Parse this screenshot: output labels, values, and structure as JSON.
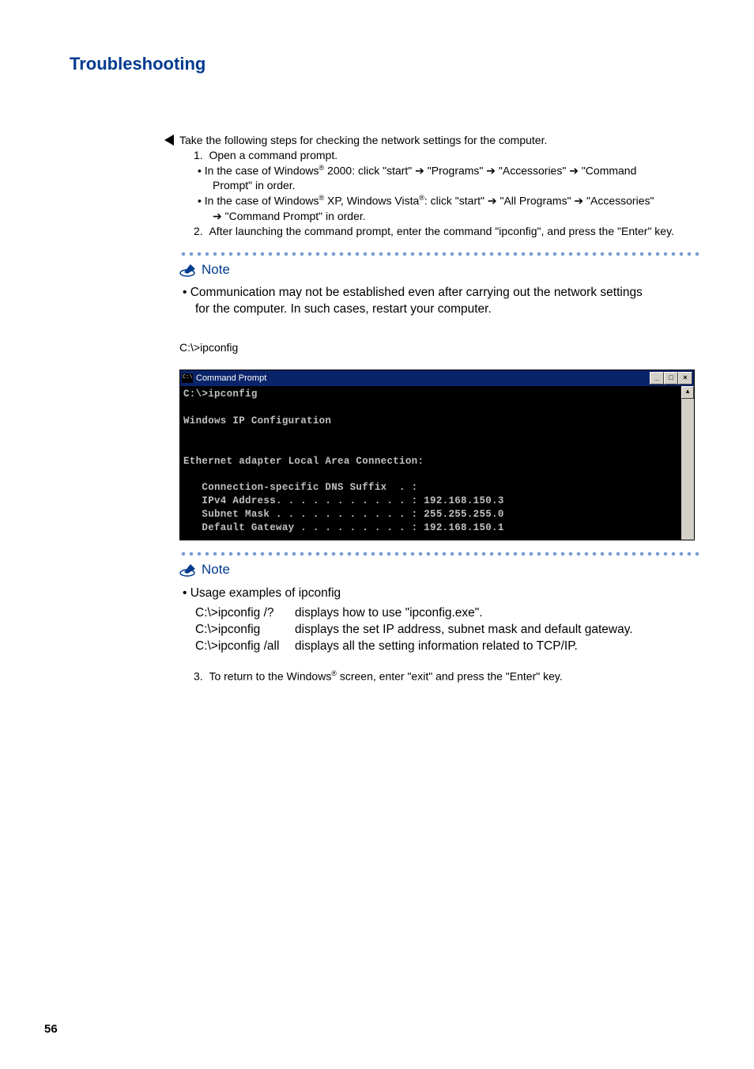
{
  "pageTitle": "Troubleshooting",
  "intro": "Take the following steps for checking the network settings for the computer.",
  "step1": {
    "num": "1.",
    "text": "Open a command prompt.",
    "bullet1a": "• In the case of Windows",
    "bullet1b": " 2000: click \"start\" ➔ \"Programs\" ➔ \"Accessories\" ➔ \"Command",
    "bullet1c": "Prompt\" in order.",
    "bullet2a": "• In the case of Windows",
    "bullet2b": " XP, Windows Vista",
    "bullet2c": ": click \"start\" ➔ \"All Programs\" ➔ \"Accessories\"",
    "bullet2d": "➔ \"Command Prompt\" in order."
  },
  "step2": {
    "num": "2.",
    "text": "After launching the command prompt, enter the command \"ipconfig\", and press the \"Enter\" key."
  },
  "note1": {
    "label": "Note",
    "line1": "• Communication may not be established even after carrying out the network settings",
    "line2": "for the computer. In such cases, restart your computer."
  },
  "cmdLabel": "C:\\>ipconfig",
  "cmdWindow": {
    "title": "Command Prompt",
    "minLabel": "_",
    "maxLabel": "□",
    "closeLabel": "×",
    "scrollUp": "▲",
    "body": "C:\\>ipconfig\n\nWindows IP Configuration\n\n\nEthernet adapter Local Area Connection:\n\n   Connection-specific DNS Suffix  . :\n   IPv4 Address. . . . . . . . . . . : 192.168.150.3\n   Subnet Mask . . . . . . . . . . . : 255.255.255.0\n   Default Gateway . . . . . . . . . : 192.168.150.1"
  },
  "note2": {
    "label": "Note",
    "head": "• Usage examples of ipconfig",
    "rows": [
      {
        "cmd": "C:\\>ipconfig /?",
        "desc": "displays how to use \"ipconfig.exe\"."
      },
      {
        "cmd": "C:\\>ipconfig",
        "desc": "displays the set IP address, subnet mask and default gateway."
      },
      {
        "cmd": "C:\\>ipconfig /all",
        "desc": "displays all the setting information related to TCP/IP."
      }
    ]
  },
  "step3": {
    "num": "3.",
    "textA": "To return to the Windows",
    "textB": " screen, enter \"exit\" and press the \"Enter\" key."
  },
  "reg": "®",
  "pageNum": "56"
}
